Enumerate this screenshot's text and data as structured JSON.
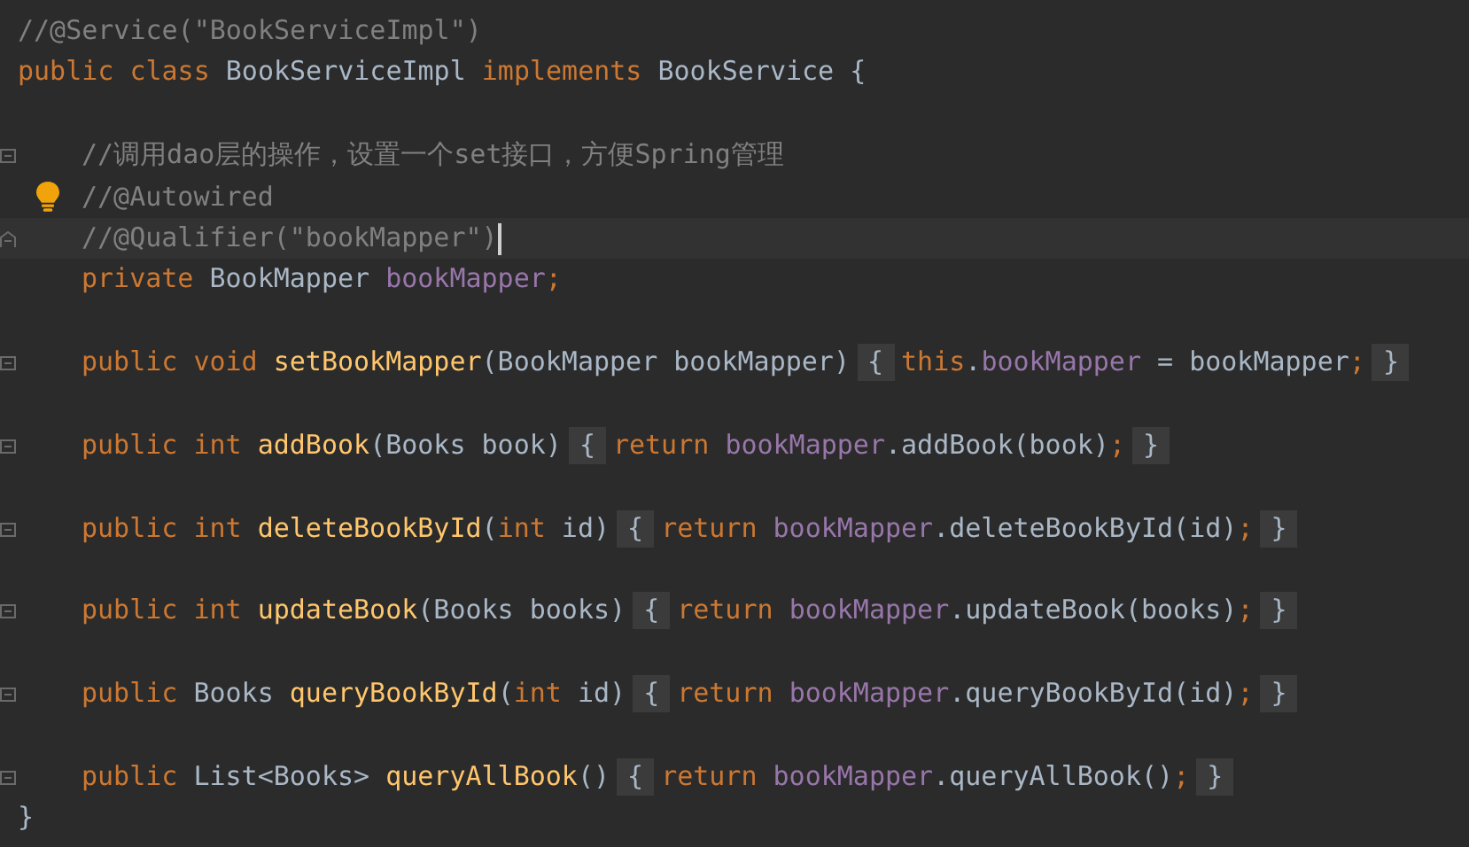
{
  "editor": {
    "lines": [
      {
        "tokens": [
          {
            "kind": "comment",
            "text": "//@Service(\"BookServiceImpl\")"
          }
        ]
      },
      {
        "tokens": [
          {
            "kind": "keyword",
            "text": "public class"
          },
          {
            "kind": "plain",
            "text": " BookServiceImpl "
          },
          {
            "kind": "keyword",
            "text": "implements"
          },
          {
            "kind": "plain",
            "text": " BookService {"
          }
        ],
        "children": [
          {
            "kind": "blank"
          },
          {
            "gutter": {
              "kind": "fold-start"
            },
            "tokens": [
              {
                "kind": "comment",
                "text": "//调用dao层的操作，设置一个set接口，方便Spring管理"
              }
            ]
          },
          {
            "gutter": {
              "kind": "bulb"
            },
            "tokens": [
              {
                "kind": "comment",
                "text": "//@Autowired"
              }
            ]
          },
          {
            "gutter": {
              "kind": "fold-end"
            },
            "current": true,
            "tokens": [
              {
                "kind": "comment",
                "text": "//@Qualifier(\"bookMapper\")"
              }
            ]
          },
          {
            "tokens": [
              {
                "kind": "keyword",
                "text": "private"
              },
              {
                "kind": "plain",
                "text": " BookMapper "
              },
              {
                "kind": "field",
                "text": "bookMapper"
              },
              {
                "kind": "keyword",
                "text": ";"
              }
            ]
          },
          {
            "kind": "blank"
          },
          {
            "gutter": {
              "kind": "fold"
            },
            "tokens": [
              {
                "kind": "keyword",
                "text": "public void"
              },
              {
                "kind": "method",
                "text": " setBookMapper"
              },
              {
                "kind": "plain",
                "text": "(BookMapper bookMapper)"
              },
              {
                "kind": "fold",
                "text": "{"
              },
              {
                "kind": "keyword",
                "text": "this"
              },
              {
                "kind": "plain",
                "text": "."
              },
              {
                "kind": "field",
                "text": "bookMapper"
              },
              {
                "kind": "plain",
                "text": " = bookMapper"
              },
              {
                "kind": "keyword",
                "text": ";"
              },
              {
                "kind": "fold",
                "text": "}"
              }
            ]
          },
          {
            "kind": "blank"
          },
          {
            "gutter": {
              "kind": "fold"
            },
            "tokens": [
              {
                "kind": "keyword",
                "text": "public int"
              },
              {
                "kind": "method",
                "text": " addBook"
              },
              {
                "kind": "plain",
                "text": "(Books book)"
              },
              {
                "kind": "fold",
                "text": "{"
              },
              {
                "kind": "keyword",
                "text": "return "
              },
              {
                "kind": "field",
                "text": "bookMapper"
              },
              {
                "kind": "plain",
                "text": ".addBook(book)"
              },
              {
                "kind": "keyword",
                "text": ";"
              },
              {
                "kind": "fold",
                "text": "}"
              }
            ]
          },
          {
            "kind": "blank"
          },
          {
            "gutter": {
              "kind": "fold"
            },
            "tokens": [
              {
                "kind": "keyword",
                "text": "public int"
              },
              {
                "kind": "method",
                "text": " deleteBookById"
              },
              {
                "kind": "plain",
                "text": "("
              },
              {
                "kind": "keyword",
                "text": "int"
              },
              {
                "kind": "plain",
                "text": " id)"
              },
              {
                "kind": "fold",
                "text": "{"
              },
              {
                "kind": "keyword",
                "text": "return "
              },
              {
                "kind": "field",
                "text": "bookMapper"
              },
              {
                "kind": "plain",
                "text": ".deleteBookById(id)"
              },
              {
                "kind": "keyword",
                "text": ";"
              },
              {
                "kind": "fold",
                "text": "}"
              }
            ]
          },
          {
            "kind": "blank"
          },
          {
            "gutter": {
              "kind": "fold"
            },
            "tokens": [
              {
                "kind": "keyword",
                "text": "public int"
              },
              {
                "kind": "method",
                "text": " updateBook"
              },
              {
                "kind": "plain",
                "text": "(Books books)"
              },
              {
                "kind": "fold",
                "text": "{"
              },
              {
                "kind": "keyword",
                "text": "return "
              },
              {
                "kind": "field",
                "text": "bookMapper"
              },
              {
                "kind": "plain",
                "text": ".updateBook(books)"
              },
              {
                "kind": "keyword",
                "text": ";"
              },
              {
                "kind": "fold",
                "text": "}"
              }
            ]
          },
          {
            "kind": "blank"
          },
          {
            "gutter": {
              "kind": "fold"
            },
            "tokens": [
              {
                "kind": "keyword",
                "text": "public"
              },
              {
                "kind": "plain",
                "text": " Books"
              },
              {
                "kind": "method",
                "text": " queryBookById"
              },
              {
                "kind": "plain",
                "text": "("
              },
              {
                "kind": "keyword",
                "text": "int"
              },
              {
                "kind": "plain",
                "text": " id)"
              },
              {
                "kind": "fold",
                "text": "{"
              },
              {
                "kind": "keyword",
                "text": "return "
              },
              {
                "kind": "field",
                "text": "bookMapper"
              },
              {
                "kind": "plain",
                "text": ".queryBookById(id)"
              },
              {
                "kind": "keyword",
                "text": ";"
              },
              {
                "kind": "fold",
                "text": "}"
              }
            ]
          },
          {
            "kind": "blank"
          },
          {
            "gutter": {
              "kind": "fold"
            },
            "tokens": [
              {
                "kind": "keyword",
                "text": "public"
              },
              {
                "kind": "plain",
                "text": " List<Books>"
              },
              {
                "kind": "method",
                "text": " queryAllBook"
              },
              {
                "kind": "plain",
                "text": "()"
              },
              {
                "kind": "fold",
                "text": "{"
              },
              {
                "kind": "keyword",
                "text": "return "
              },
              {
                "kind": "field",
                "text": "bookMapper"
              },
              {
                "kind": "plain",
                "text": ".queryAllBook()"
              },
              {
                "kind": "keyword",
                "text": ";"
              },
              {
                "kind": "fold",
                "text": "}"
              }
            ]
          }
        ]
      },
      {
        "tokens": [
          {
            "kind": "plain",
            "text": "}"
          }
        ]
      }
    ]
  }
}
